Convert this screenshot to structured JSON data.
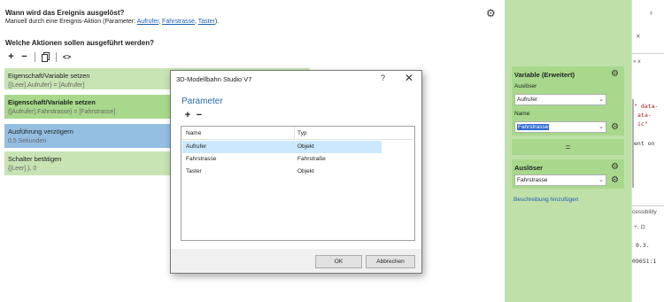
{
  "editor": {
    "trigger_question": "Wann wird das Ereignis ausgelöst?",
    "trigger_prefix": "Manuell durch eine Ereignis-Aktion (Parameter: ",
    "trigger_params": [
      "Aufrufer",
      "Fahrstrasse",
      "Taster"
    ],
    "trigger_sep": ", ",
    "trigger_suffix": ").",
    "actions_question": "Welche Aktionen sollen ausgeführt werden?",
    "toolbar": {
      "add": "+",
      "remove": "−",
      "copy_icon": "copy-icon",
      "code": "<>"
    },
    "actions": [
      {
        "title": "Eigenschaft/Variable setzen",
        "detail": "{[Leer].Aufrufer} = [Aufrufer]"
      },
      {
        "title": "Eigenschaft/Variable setzen",
        "detail": "{[Aufrufer].Fahrstrasse} = [Fahrstrasse]"
      },
      {
        "title": "Ausführung verzögern",
        "detail": "0,5 Sekunden"
      },
      {
        "title": "Schalter betätigen",
        "detail": "{[Leer].}, 0"
      }
    ]
  },
  "dialog": {
    "window_title": "3D-Modellbahn Studio V7",
    "help": "?",
    "close": "✕",
    "heading": "Parameter",
    "add": "+",
    "remove": "−",
    "columns": [
      "Name",
      "Typ"
    ],
    "rows": [
      {
        "name": "Aufrufer",
        "type": "Objekt",
        "selected": true
      },
      {
        "name": "Fahrstrasse",
        "type": "Fahrstraße",
        "selected": false
      },
      {
        "name": "Taster",
        "type": "Objekt",
        "selected": false
      }
    ],
    "ok": "OK",
    "cancel": "Abbrechen"
  },
  "panel": {
    "variable_title": "Variable (Erweitert)",
    "ausloeser_label": "Auslöser",
    "ausloeser_value": "Aufrufer",
    "name_label": "Name",
    "name_value": "Fahrstrasse",
    "equals": "=",
    "trigger_title": "Auslöser",
    "trigger_value": "Fahrstrasse",
    "description_link": "Beschreibung hinzufügen"
  },
  "devtools": {
    "lines": [
      "‹",
      "» x",
      "✕",
      "\" data-",
      "ata-",
      "ic\"",
      "ent on",
      "cessibility",
      "+, ⊡",
      "0.3.",
      "09651:1"
    ]
  },
  "colors": {
    "action_light": "#c8e4b4",
    "action_dark": "#a8d88c",
    "action_selected": "#94bfe3",
    "panel_bg": "#bfe0a8",
    "link": "#1a5fb4",
    "heading_blue": "#2a6aa8"
  }
}
